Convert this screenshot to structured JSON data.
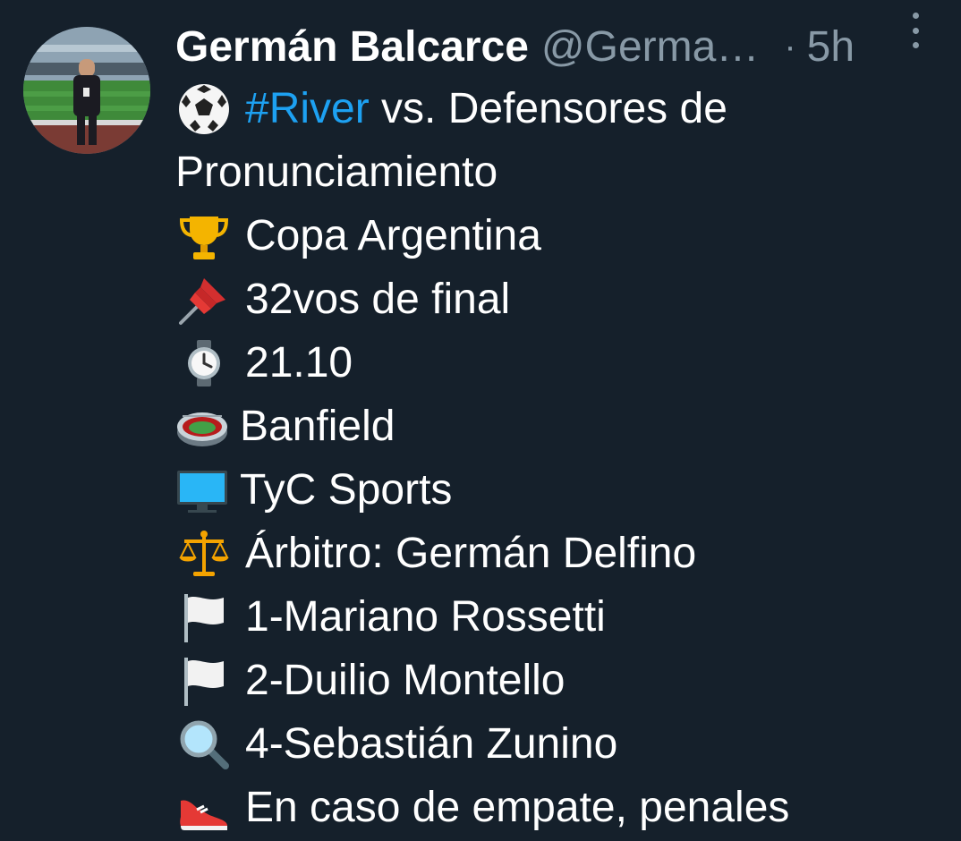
{
  "tweet": {
    "author": {
      "display_name": "Germán Balcarce",
      "handle": "@Germa…",
      "separator": "·",
      "time": "5h"
    },
    "text_first_line": {
      "hashtag": "#River",
      "rest": " vs. Defensores de"
    },
    "lines": [
      "Pronunciamiento",
      "Copa Argentina",
      "32vos de final",
      "21.10",
      "Banfield",
      "TyC Sports",
      "Árbitro: Germán Delfino",
      "1-Mariano Rossetti",
      "2-Duilio Montello",
      "4-Sebastián Zunino",
      "En caso de empate, penales"
    ],
    "icons": [
      "soccer-ball-icon",
      "trophy-icon",
      "pushpin-icon",
      "watch-icon",
      "stadium-icon",
      "television-icon",
      "balance-scale-icon",
      "white-flag-icon",
      "white-flag-icon",
      "magnifying-glass-icon",
      "running-shoe-icon"
    ],
    "colors": {
      "background": "#15202b",
      "text": "#ffffff",
      "secondary": "#8899a6",
      "link": "#1da1f2"
    }
  }
}
